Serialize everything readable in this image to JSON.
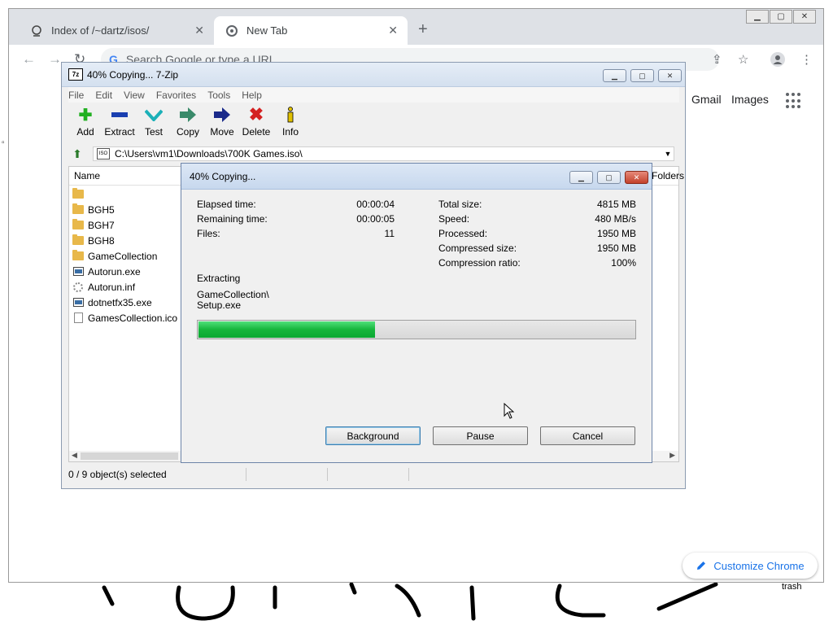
{
  "chrome": {
    "tabs": [
      {
        "label": "Index of /~dartz/isos/",
        "active": false
      },
      {
        "label": "New Tab",
        "active": true
      }
    ],
    "omnibox_placeholder": "Search Google or type a URL",
    "links": {
      "gmail": "Gmail",
      "images": "Images"
    },
    "customize_label": "Customize Chrome",
    "accent": "#1a73e8"
  },
  "desktop": {
    "trash_label": "trash"
  },
  "zip": {
    "title": "40% Copying... 7-Zip",
    "icon_text": "7z",
    "menu": [
      "File",
      "Edit",
      "View",
      "Favorites",
      "Tools",
      "Help"
    ],
    "toolbar": [
      {
        "label": "Add",
        "icon": "plus-icon"
      },
      {
        "label": "Extract",
        "icon": "minus-icon"
      },
      {
        "label": "Test",
        "icon": "check-icon"
      },
      {
        "label": "Copy",
        "icon": "copy-arrow-icon"
      },
      {
        "label": "Move",
        "icon": "move-arrow-icon"
      },
      {
        "label": "Delete",
        "icon": "x-icon"
      },
      {
        "label": "Info",
        "icon": "info-icon"
      }
    ],
    "address": "C:\\Users\\vm1\\Downloads\\700K Games.iso\\",
    "columns": {
      "name": "Name",
      "folders": "Folders"
    },
    "files": [
      {
        "name": "",
        "type": "folder"
      },
      {
        "name": "BGH5",
        "type": "folder"
      },
      {
        "name": "BGH7",
        "type": "folder"
      },
      {
        "name": "BGH8",
        "type": "folder"
      },
      {
        "name": "GameCollection",
        "type": "folder"
      },
      {
        "name": "Autorun.exe",
        "type": "exe"
      },
      {
        "name": "Autorun.inf",
        "type": "inf"
      },
      {
        "name": "dotnetfx35.exe",
        "type": "exe"
      },
      {
        "name": "GamesCollection.ico",
        "type": "ico"
      }
    ],
    "status": "0 / 9 object(s) selected"
  },
  "dialog": {
    "title": "40% Copying...",
    "left_stats": [
      {
        "label": "Elapsed time:",
        "value": "00:00:04"
      },
      {
        "label": "Remaining time:",
        "value": "00:00:05"
      },
      {
        "label": "Files:",
        "value": "11"
      }
    ],
    "right_stats": [
      {
        "label": "Total size:",
        "value": "4815 MB"
      },
      {
        "label": "Speed:",
        "value": "480 MB/s"
      },
      {
        "label": "Processed:",
        "value": "1950 MB"
      },
      {
        "label": "Compressed size:",
        "value": "1950 MB"
      },
      {
        "label": "Compression ratio:",
        "value": "100%"
      }
    ],
    "operation": "Extracting",
    "current_path_1": "GameCollection\\",
    "current_path_2": "Setup.exe",
    "progress": 0.405,
    "progress_color": "#16b63c",
    "buttons": {
      "background": "Background",
      "pause": "Pause",
      "cancel": "Cancel"
    }
  }
}
